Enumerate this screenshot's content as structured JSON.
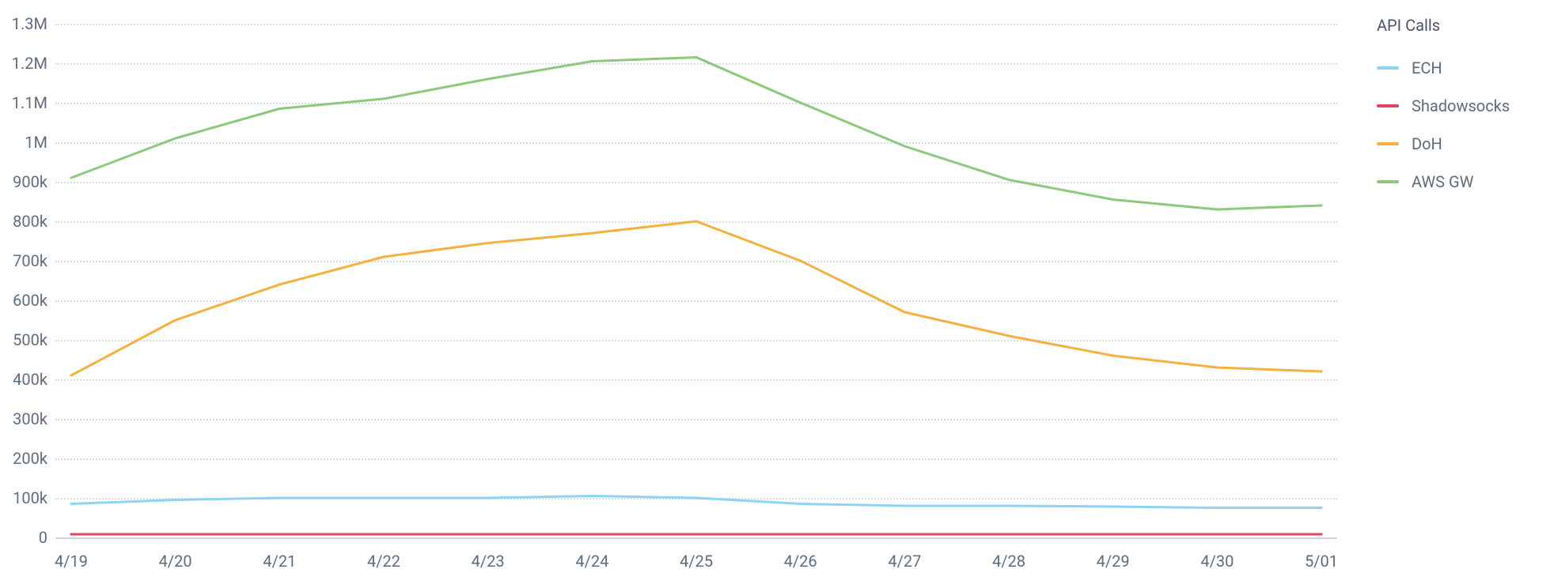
{
  "chart_data": {
    "type": "line",
    "title": "API Calls",
    "xlabel": "",
    "ylabel": "",
    "ylim": [
      0,
      1300000
    ],
    "categories": [
      "4/19",
      "4/20",
      "4/21",
      "4/22",
      "4/23",
      "4/24",
      "4/25",
      "4/26",
      "4/27",
      "4/28",
      "4/29",
      "4/30",
      "5/01"
    ],
    "y_ticks": [
      {
        "v": 0,
        "label": "0"
      },
      {
        "v": 100000,
        "label": "100k"
      },
      {
        "v": 200000,
        "label": "200k"
      },
      {
        "v": 300000,
        "label": "300k"
      },
      {
        "v": 400000,
        "label": "400k"
      },
      {
        "v": 500000,
        "label": "500k"
      },
      {
        "v": 600000,
        "label": "600k"
      },
      {
        "v": 700000,
        "label": "700k"
      },
      {
        "v": 800000,
        "label": "800k"
      },
      {
        "v": 900000,
        "label": "900k"
      },
      {
        "v": 1000000,
        "label": "1M"
      },
      {
        "v": 1100000,
        "label": "1.1M"
      },
      {
        "v": 1200000,
        "label": "1.2M"
      },
      {
        "v": 1300000,
        "label": "1.3M"
      }
    ],
    "series": [
      {
        "name": "ECH",
        "color": "#8fd3f4",
        "values": [
          85000,
          95000,
          100000,
          100000,
          100000,
          105000,
          100000,
          85000,
          80000,
          80000,
          78000,
          75000,
          75000
        ]
      },
      {
        "name": "Shadowsocks",
        "color": "#e2445c",
        "values": [
          8000,
          8000,
          8000,
          8000,
          8000,
          8000,
          8000,
          8000,
          8000,
          8000,
          8000,
          8000,
          8000
        ]
      },
      {
        "name": "DoH",
        "color": "#f5b041",
        "values": [
          410000,
          550000,
          640000,
          710000,
          745000,
          770000,
          800000,
          700000,
          570000,
          510000,
          460000,
          430000,
          420000
        ]
      },
      {
        "name": "AWS GW",
        "color": "#8cc97b",
        "values": [
          910000,
          1010000,
          1085000,
          1110000,
          1160000,
          1205000,
          1215000,
          1100000,
          990000,
          905000,
          855000,
          830000,
          840000
        ]
      }
    ]
  },
  "legend": {
    "title": "API Calls",
    "items": [
      {
        "label": "ECH",
        "color": "#8fd3f4"
      },
      {
        "label": "Shadowsocks",
        "color": "#e2445c"
      },
      {
        "label": "DoH",
        "color": "#f5b041"
      },
      {
        "label": "AWS GW",
        "color": "#8cc97b"
      }
    ]
  }
}
